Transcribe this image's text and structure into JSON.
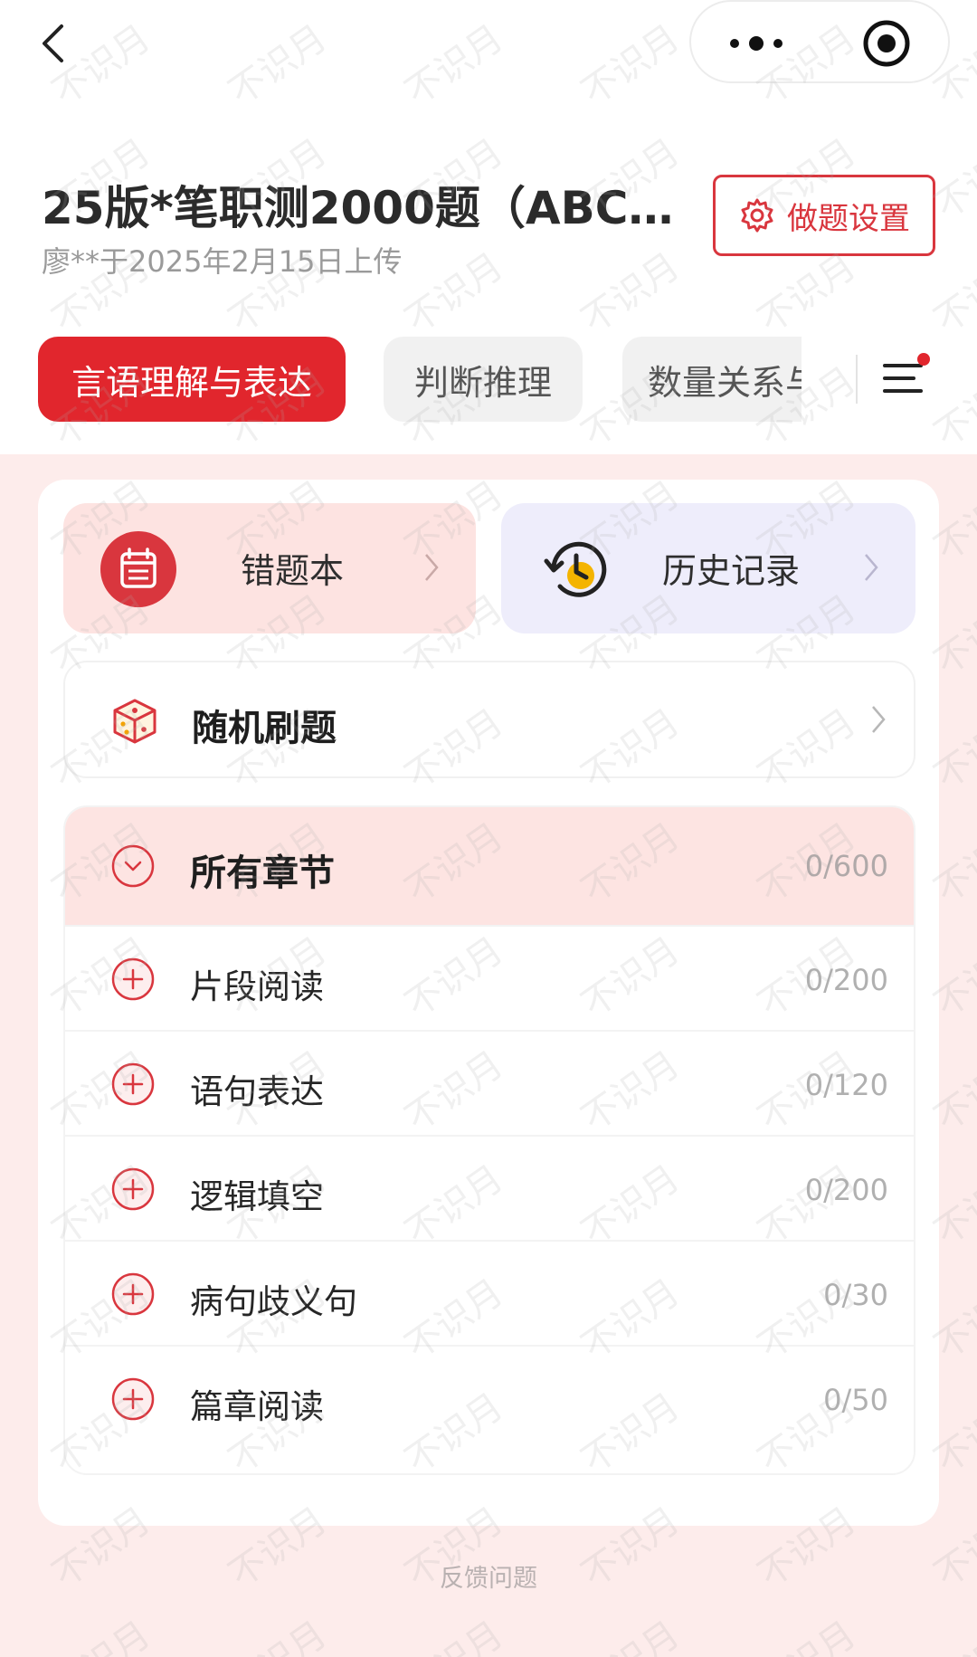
{
  "nav": {
    "back_icon": "chevron-left-icon",
    "more_icon": "more-dots-icon",
    "target_icon": "target-icon"
  },
  "header": {
    "title": "25版*笔职测2000题（ABCD…",
    "subtitle": "廖**于2025年2月15日上传",
    "settings_label": "做题设置",
    "settings_icon": "gear-icon"
  },
  "tabs": [
    {
      "label": "言语理解与表达",
      "active": true
    },
    {
      "label": "判断推理",
      "active": false
    },
    {
      "label": "数量关系与",
      "active": false
    }
  ],
  "menu_icon": "menu-lines-icon",
  "quick": {
    "wrong_book": "错题本",
    "history": "历史记录"
  },
  "random": {
    "label": "随机刷题"
  },
  "chapters": {
    "all": {
      "label": "所有章节",
      "count": "0/600"
    },
    "items": [
      {
        "label": "片段阅读",
        "count": "0/200"
      },
      {
        "label": "语句表达",
        "count": "0/120"
      },
      {
        "label": "逻辑填空",
        "count": "0/200"
      },
      {
        "label": "病句歧义句",
        "count": "0/30"
      },
      {
        "label": "篇章阅读",
        "count": "0/50"
      }
    ]
  },
  "feedback": "反馈问题",
  "watermark": "不识月",
  "colors": {
    "accent": "#e1262d",
    "pink_bg": "#fdeceb",
    "history_bg": "#eeedfb"
  }
}
